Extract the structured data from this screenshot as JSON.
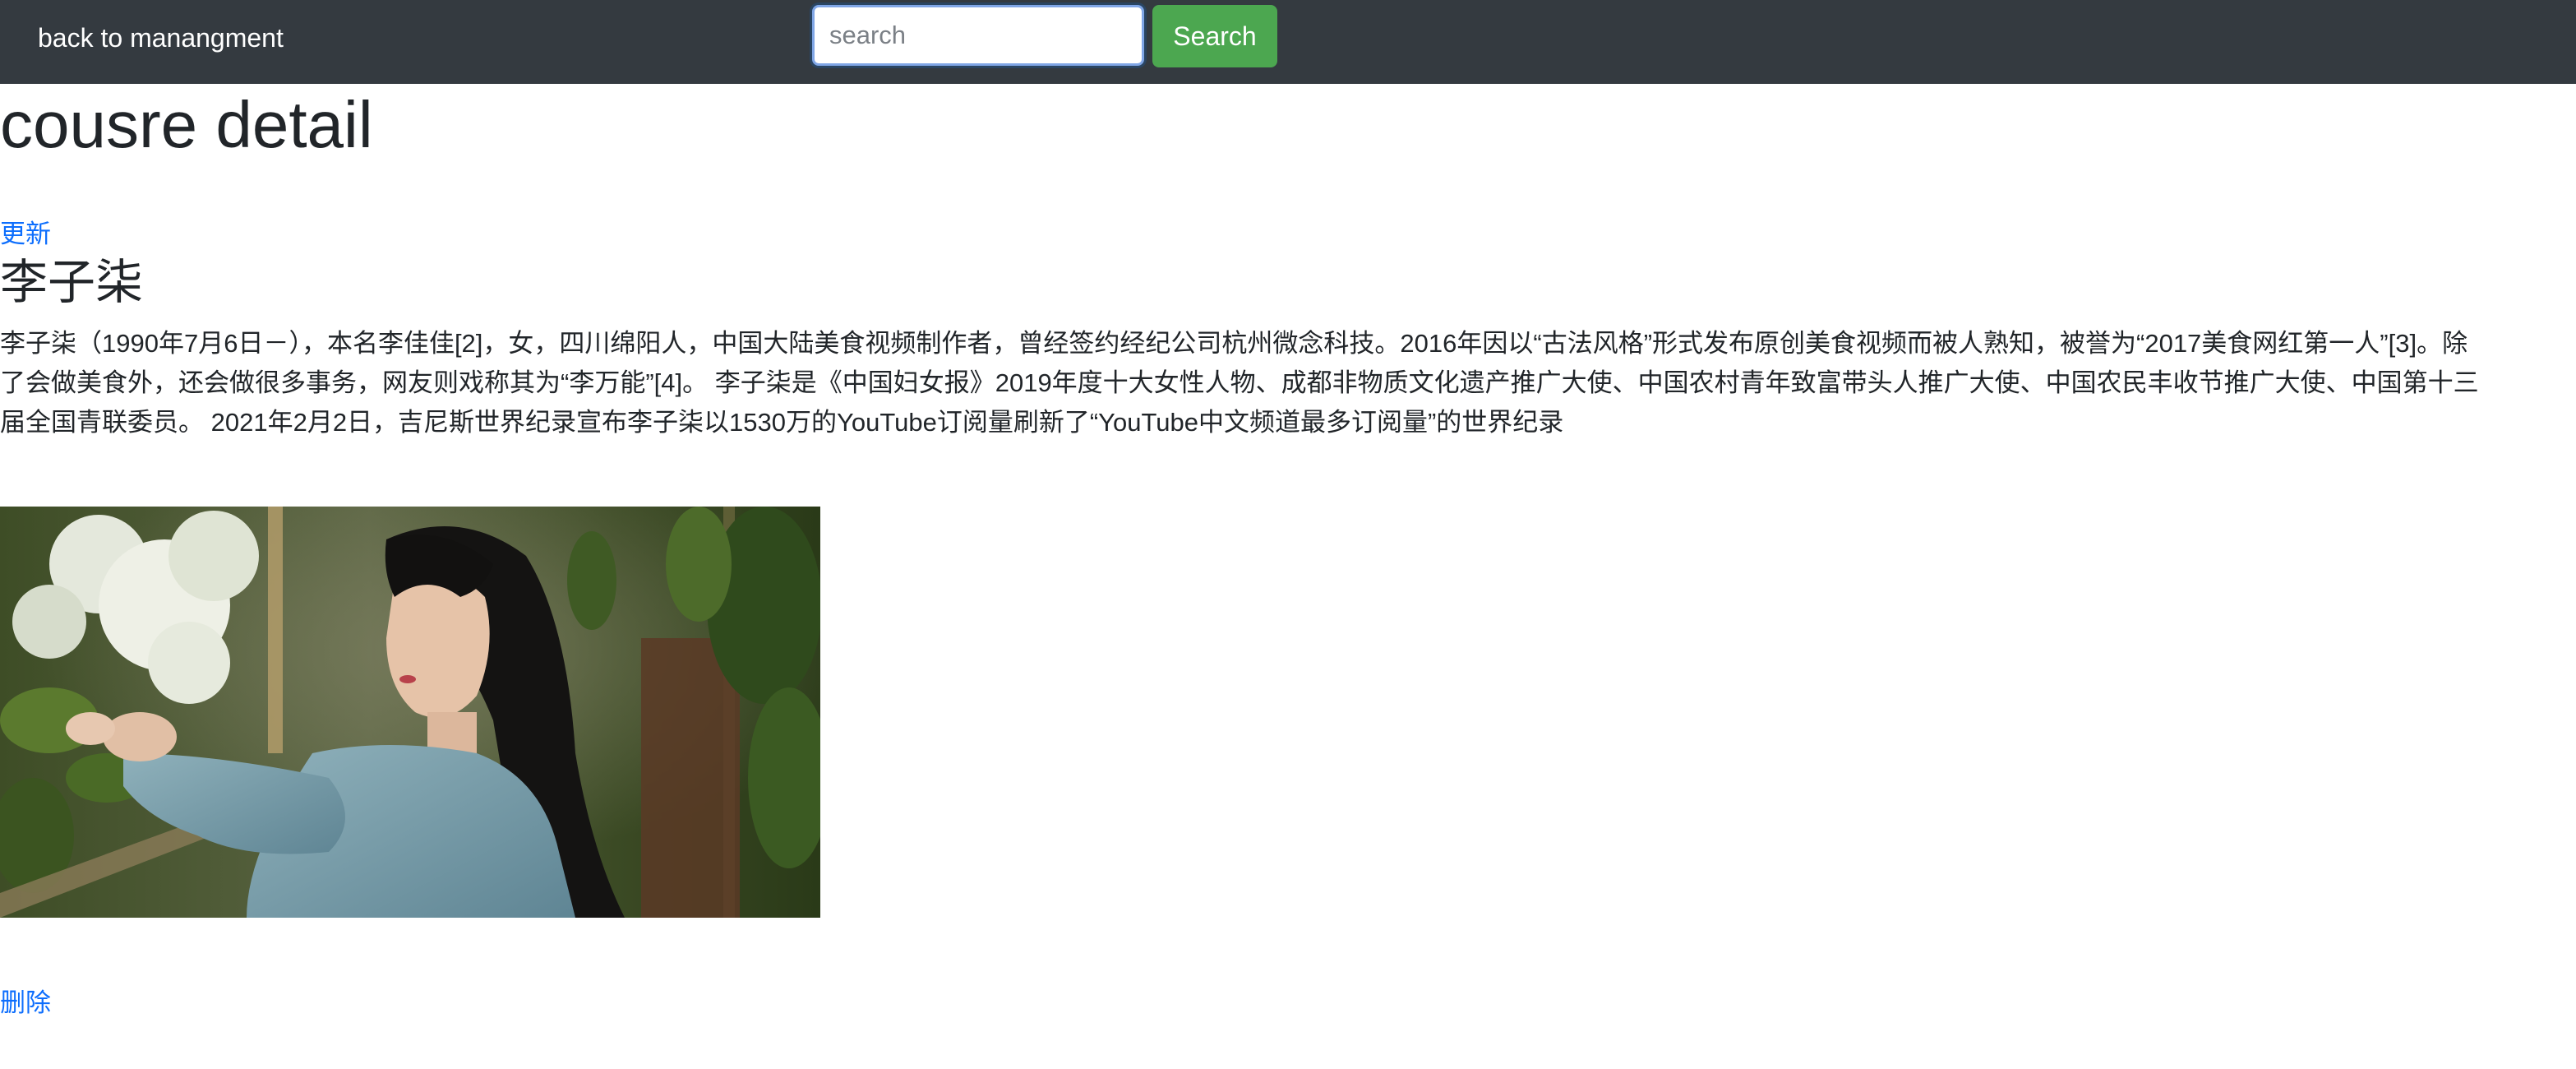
{
  "navbar": {
    "brand_label": "back to manangment",
    "search_placeholder": "search",
    "search_value": "",
    "search_button_label": "Search"
  },
  "page": {
    "title": "cousre detail",
    "update_link": "更新",
    "delete_link": "删除"
  },
  "course": {
    "name": "李子柒",
    "description_lines": [
      "李子柒（1990年7月6日－），本名李佳佳[2]，女，四川绵阳人，中国大陆美食视频制作者，曾经签约经纪公司杭州微念科技。2016年因以“古法风格”形式发布原创美食视频而被人熟知，被誉为“2017美食网红第一人”[3]。除",
      "了会做美食外，还会做很多事务，网友则戏称其为“李万能”[4]。 李子柒是《中国妇女报》2019年度十大女性人物、成都非物质文化遗产推广大使、中国农村青年致富带头人推广大使、中国农民丰收节推广大使、中国第十三",
      "届全国青联委员。 2021年2月2日，吉尼斯世界纪录宣布李子柒以1530万的YouTube订阅量刷新了“YouTube中文频道最多订阅量”的世界纪录"
    ]
  },
  "colors": {
    "navbar_bg": "#343a40",
    "search_button_bg": "#4ca750",
    "link": "#0d6efd"
  }
}
